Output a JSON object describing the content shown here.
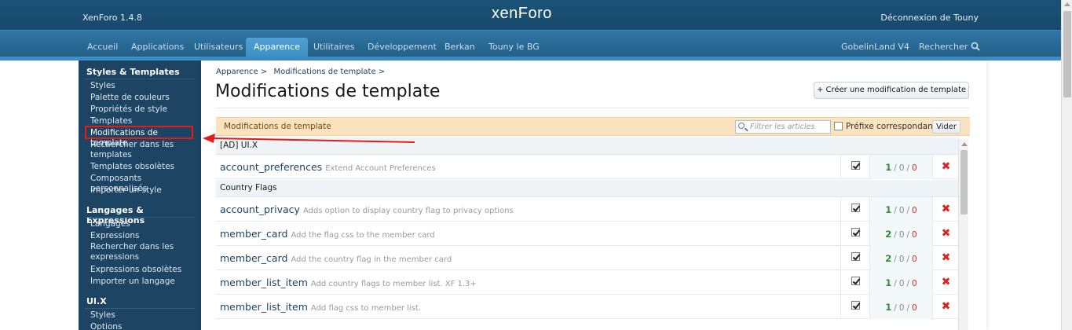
{
  "header": {
    "version": "XenForo 1.4.8",
    "logo": "xenForo",
    "logout": "Déconnexion de Touny"
  },
  "nav": {
    "tabs": [
      "Accueil",
      "Applications",
      "Utilisateurs",
      "Apparence",
      "Utilitaires",
      "Développement",
      "Berkan",
      "Touny le BG"
    ],
    "active": "Apparence",
    "right_link": "GobelinLand V4",
    "search": "Rechercher"
  },
  "sidebar": {
    "sections": [
      {
        "title": "Styles & Templates",
        "links": [
          "Styles",
          "Palette de couleurs",
          "Propriétés de style",
          "Templates",
          "Modifications de template",
          "Rechercher dans les templates",
          "Templates obsolètes",
          "Composants personnalisés",
          "Importer un style"
        ]
      },
      {
        "title": "Langages & Expressions",
        "links": [
          "Langages",
          "Expressions",
          "Rechercher dans les expressions",
          "Expressions obsolètes",
          "Importer un langage"
        ]
      },
      {
        "title": "UI.X",
        "links": [
          "Styles",
          "Options"
        ]
      }
    ]
  },
  "main": {
    "breadcrumb": [
      "Apparence >",
      "Modifications de template >"
    ],
    "title": "Modifications de template",
    "create_button": "+ Créer une modification de template",
    "filter_label": "Modifications de template",
    "filter_placeholder": "Filtrer les articles",
    "prefix_label": "Préfixe correspondant",
    "clear_button": "Vider",
    "groups": [
      {
        "name": "[AD] UI.X",
        "rows": [
          {
            "name": "account_preferences",
            "desc": "Extend Account Preferences",
            "a": "1",
            "b": "0",
            "c": "0"
          }
        ]
      },
      {
        "name": "Country Flags",
        "rows": [
          {
            "name": "account_privacy",
            "desc": "Adds option to display country flag to privacy options",
            "a": "1",
            "b": "0",
            "c": "0"
          },
          {
            "name": "member_card",
            "desc": "Add the flag css to the member card",
            "a": "2",
            "b": "0",
            "c": "0"
          },
          {
            "name": "member_card",
            "desc": "Add the country flag in the member card",
            "a": "2",
            "b": "0",
            "c": "0"
          },
          {
            "name": "member_list_item",
            "desc": "Add country flags to member list. XF 1.3+",
            "a": "1",
            "b": "0",
            "c": "0"
          },
          {
            "name": "member_list_item",
            "desc": "Add flag css to member list.",
            "a": "1",
            "b": "0",
            "c": "0"
          }
        ]
      }
    ]
  },
  "colors": {
    "header_bg": "#1b5176",
    "nav_bg": "#2e77a5",
    "active_tab": "#4fa1d4",
    "sidebar_bg": "#1d4463",
    "filter_bg": "#fbe3bf",
    "count_green": "#2e8b2e",
    "count_red": "#cc2b2b",
    "annotation_red": "#e41b1b"
  }
}
